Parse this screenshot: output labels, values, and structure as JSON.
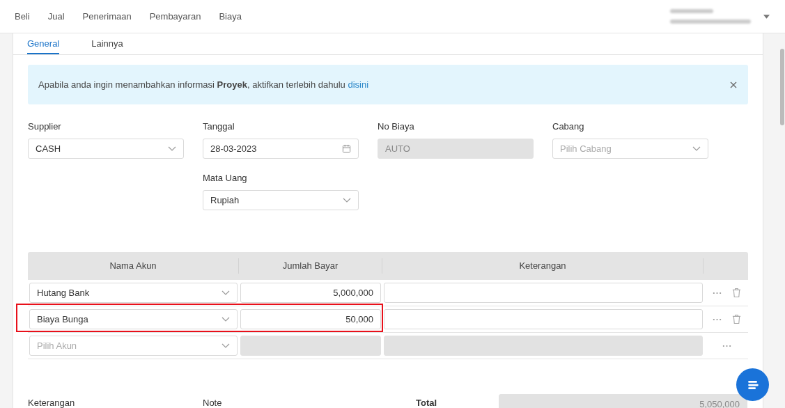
{
  "nav": {
    "items": [
      {
        "label": "Beli"
      },
      {
        "label": "Jual"
      },
      {
        "label": "Penerimaan"
      },
      {
        "label": "Pembayaran"
      },
      {
        "label": "Biaya"
      }
    ]
  },
  "tabs": [
    {
      "label": "General",
      "selected": true
    },
    {
      "label": "Lainnya",
      "selected": false
    }
  ],
  "alert": {
    "text": "Apabila anda ingin menambahkan informasi **Proyek**, aktifkan terlebih dahulu",
    "link": "disini"
  },
  "fields": [
    {
      "label": "Supplier",
      "kind": "select",
      "value": "CASH"
    },
    {
      "label": "Tanggal",
      "kind": "date",
      "value": "28-03-2023"
    },
    {
      "label": "No Biaya",
      "kind": "text",
      "value": "AUTO",
      "disabled": true
    },
    {
      "label": "Cabang",
      "kind": "select",
      "placeholder": "Pilih Cabang"
    },
    {
      "label": "Mata Uang",
      "kind": "select",
      "value": "Rupiah"
    }
  ],
  "table": {
    "columns": [
      "Nama Akun",
      "Jumlah Bayar",
      "Keterangan"
    ],
    "rows": [
      {
        "account": "Hutang Bank",
        "amount": "5,000,000",
        "disabled": false,
        "highlighted": false,
        "deletable": true
      },
      {
        "account": "Biaya Bunga",
        "amount": "50,000",
        "disabled": false,
        "highlighted": true,
        "deletable": true
      },
      {
        "account_placeholder": "Pilih Akun",
        "disabled": true,
        "highlighted": false,
        "deletable": false
      }
    ]
  },
  "footer": {
    "labels": [
      "Keterangan",
      "Note",
      "Total"
    ],
    "total": "5,050,000"
  }
}
